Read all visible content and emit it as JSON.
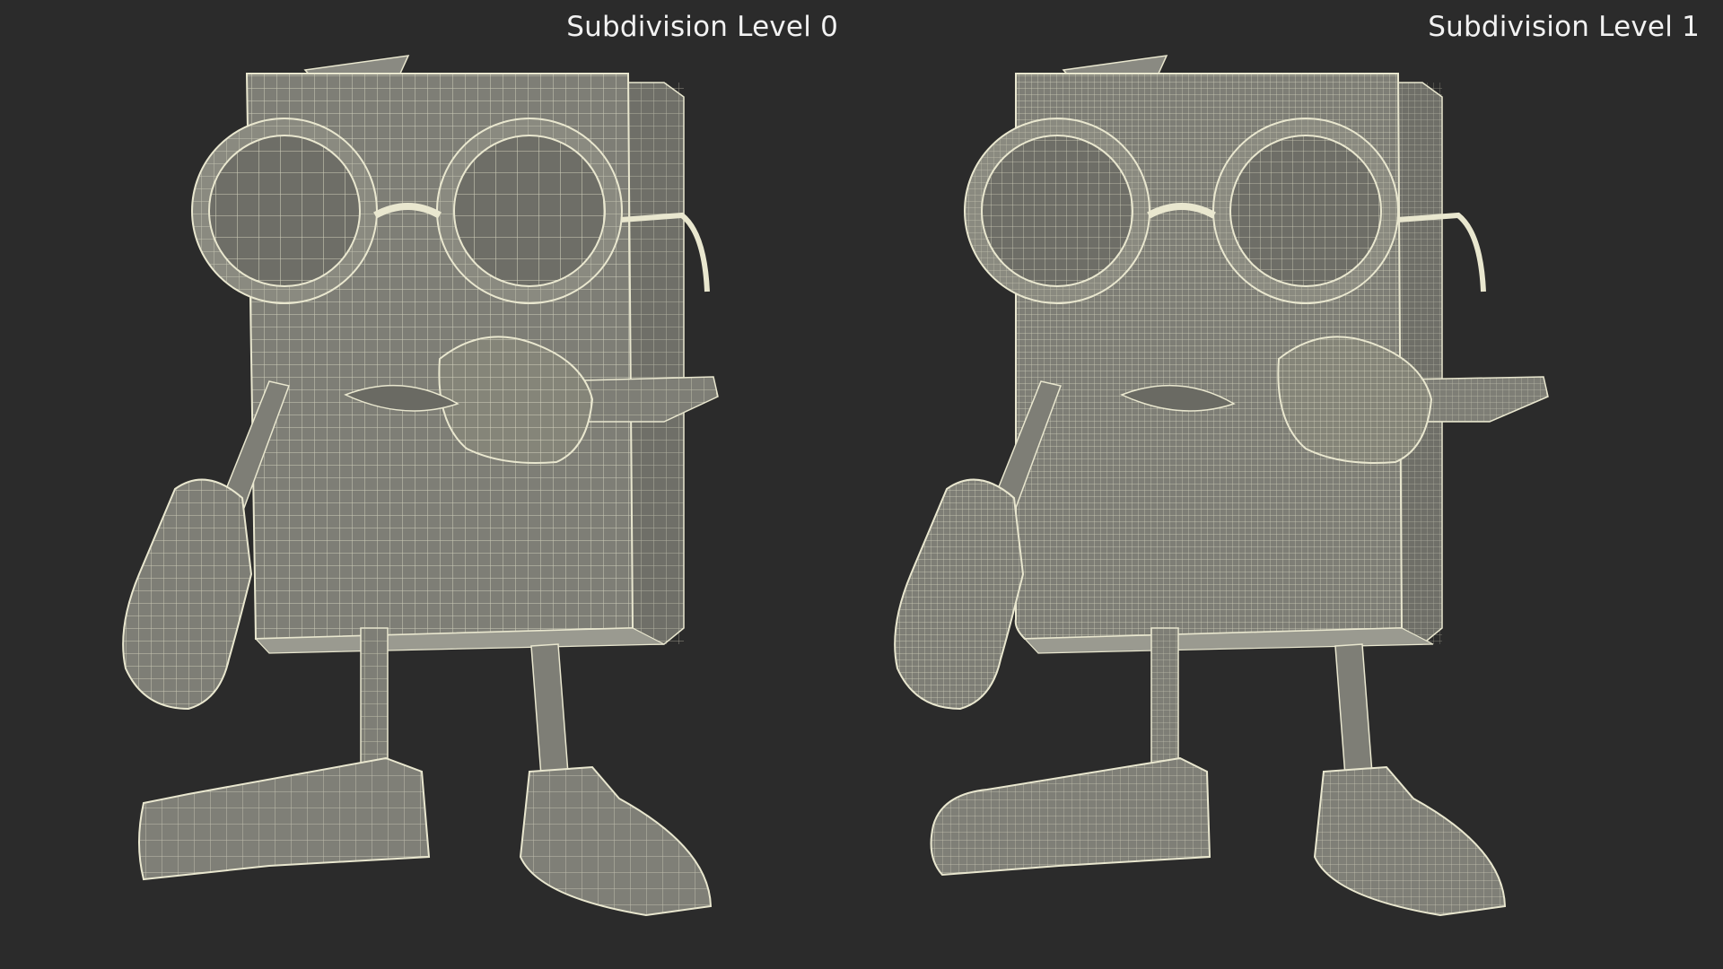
{
  "panels": [
    {
      "id": "level-0",
      "label": "Subdivision Level 0",
      "grid_density": "coarse"
    },
    {
      "id": "level-1",
      "label": "Subdivision Level 1",
      "grid_density": "fine"
    }
  ],
  "colors": {
    "background": "#2b2b2b",
    "surface": "#7b7b73",
    "surface_light": "#8e8e86",
    "surface_dark": "#5f5f59",
    "wire": "#e9e7cf",
    "label": "#f2f2f2"
  }
}
